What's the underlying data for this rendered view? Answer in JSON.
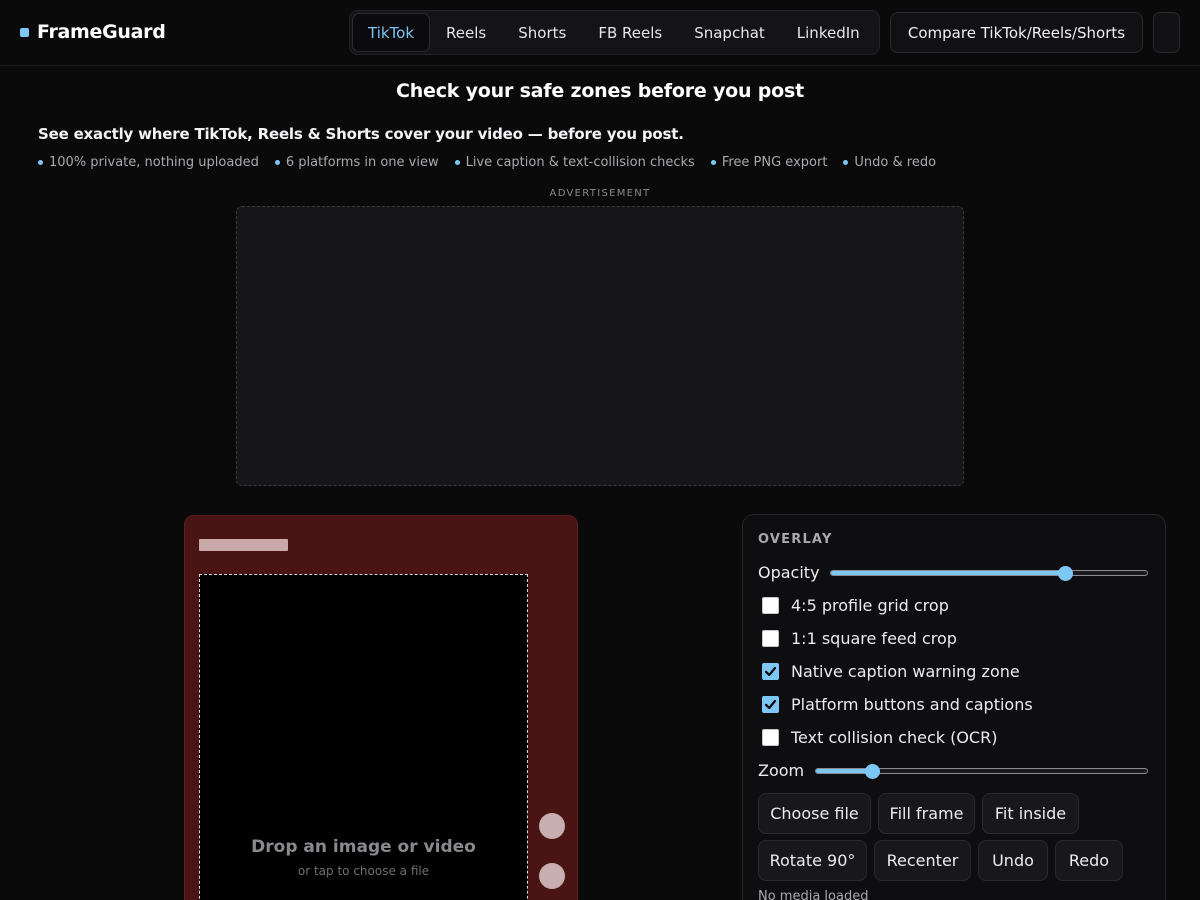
{
  "brand": {
    "name": "FrameGuard"
  },
  "nav": {
    "tabs": [
      {
        "label": "TikTok",
        "active": true
      },
      {
        "label": "Reels",
        "active": false
      },
      {
        "label": "Shorts",
        "active": false
      },
      {
        "label": "FB Reels",
        "active": false
      },
      {
        "label": "Snapchat",
        "active": false
      },
      {
        "label": "LinkedIn",
        "active": false
      }
    ],
    "compare_label": "Compare TikTok/Reels/Shorts"
  },
  "hero": {
    "title": "Check your safe zones before you post",
    "tagline": "See exactly where TikTok, Reels & Shorts cover your video — before you post.",
    "features": [
      "100% private, nothing uploaded",
      "6 platforms in one view",
      "Live caption & text-collision checks",
      "Free PNG export",
      "Undo & redo"
    ]
  },
  "ad": {
    "label": "ADVERTISEMENT"
  },
  "preview": {
    "drop_title": "Drop an image or video",
    "drop_subtitle": "or tap to choose a file"
  },
  "overlay": {
    "title": "OVERLAY",
    "opacity_label": "Opacity",
    "opacity_value": 0.74,
    "checkboxes": [
      {
        "label": "4:5 profile grid crop",
        "checked": false
      },
      {
        "label": "1:1 square feed crop",
        "checked": false
      },
      {
        "label": "Native caption warning zone",
        "checked": true
      },
      {
        "label": "Platform buttons and captions",
        "checked": true
      },
      {
        "label": "Text collision check (OCR)",
        "checked": false
      }
    ],
    "zoom_label": "Zoom",
    "zoom_value": 0.17,
    "buttons_row1": [
      "Choose file",
      "Fill frame",
      "Fit inside"
    ],
    "buttons_row2": [
      "Rotate 90°",
      "Recenter",
      "Undo",
      "Redo"
    ],
    "status": "No media loaded"
  },
  "colors": {
    "accent": "#7cc7f5",
    "background": "#0a0a0b",
    "preview_frame": "#4a1414"
  }
}
